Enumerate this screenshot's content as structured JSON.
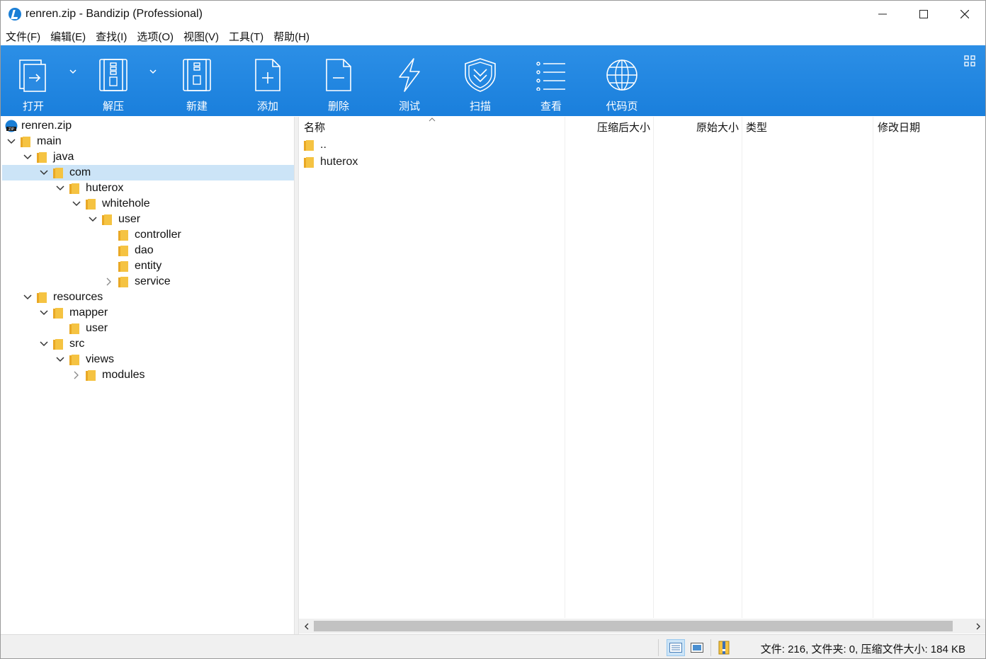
{
  "window": {
    "title": "renren.zip - Bandizip (Professional)"
  },
  "menu": [
    {
      "label": "文件(F)"
    },
    {
      "label": "编辑(E)"
    },
    {
      "label": "查找(I)"
    },
    {
      "label": "选项(O)"
    },
    {
      "label": "视图(V)"
    },
    {
      "label": "工具(T)"
    },
    {
      "label": "帮助(H)"
    }
  ],
  "toolbar": {
    "open_label": "打开",
    "extract_label": "解压",
    "new_label": "新建",
    "add_label": "添加",
    "delete_label": "删除",
    "test_label": "测试",
    "scan_label": "扫描",
    "view_label": "查看",
    "codepage_label": "代码页"
  },
  "tree": {
    "root": "renren.zip",
    "nodes": [
      {
        "label": "main",
        "state": "expanded"
      },
      {
        "label": "java",
        "state": "expanded"
      },
      {
        "label": "com",
        "state": "expanded",
        "selected": true
      },
      {
        "label": "huterox",
        "state": "expanded"
      },
      {
        "label": "whitehole",
        "state": "expanded"
      },
      {
        "label": "user",
        "state": "expanded"
      },
      {
        "label": "controller",
        "state": "leaf"
      },
      {
        "label": "dao",
        "state": "leaf"
      },
      {
        "label": "entity",
        "state": "leaf"
      },
      {
        "label": "service",
        "state": "collapsed"
      },
      {
        "label": "resources",
        "state": "expanded"
      },
      {
        "label": "mapper",
        "state": "expanded"
      },
      {
        "label": "user",
        "state": "leaf"
      },
      {
        "label": "src",
        "state": "expanded"
      },
      {
        "label": "views",
        "state": "expanded"
      },
      {
        "label": "modules",
        "state": "collapsed"
      }
    ]
  },
  "list": {
    "columns": {
      "name": "名称",
      "compressed": "压缩后大小",
      "original": "原始大小",
      "type": "类型",
      "modified": "修改日期"
    },
    "rows": [
      {
        "name": ".."
      },
      {
        "name": "huterox"
      }
    ]
  },
  "status": {
    "text": "文件: 216, 文件夹: 0, 压缩文件大小: 184 KB"
  },
  "colors": {
    "toolbar": "#1a7fdc",
    "selection": "#cce4f7",
    "folder": "#f5c342"
  }
}
